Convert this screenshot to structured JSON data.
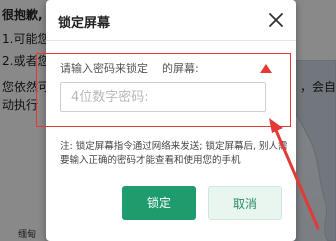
{
  "background": {
    "lines": [
      "很抱歉,",
      "1.可能您",
      "2.或者您",
      "您依然可",
      "动执行"
    ],
    "right_fragment": "，会自",
    "bottom_label": "缅甸"
  },
  "dialog": {
    "title": "锁定屏幕",
    "label_left": "请输入密码来锁定",
    "label_right": "的屏幕:",
    "password": {
      "placeholder": "4位数字密码:",
      "value": ""
    },
    "note": "注: 锁定屏幕指令通过网络来发送; 锁定屏幕后, 别人需要输入正确的密码才能查看和使用您的手机",
    "confirm_label": "锁定",
    "cancel_label": "取消"
  },
  "colors": {
    "primary": "#1e9c6e",
    "annotation": "#e53935"
  },
  "icons": {
    "close": "close-icon",
    "warning_marker": "triangle-up-icon"
  }
}
